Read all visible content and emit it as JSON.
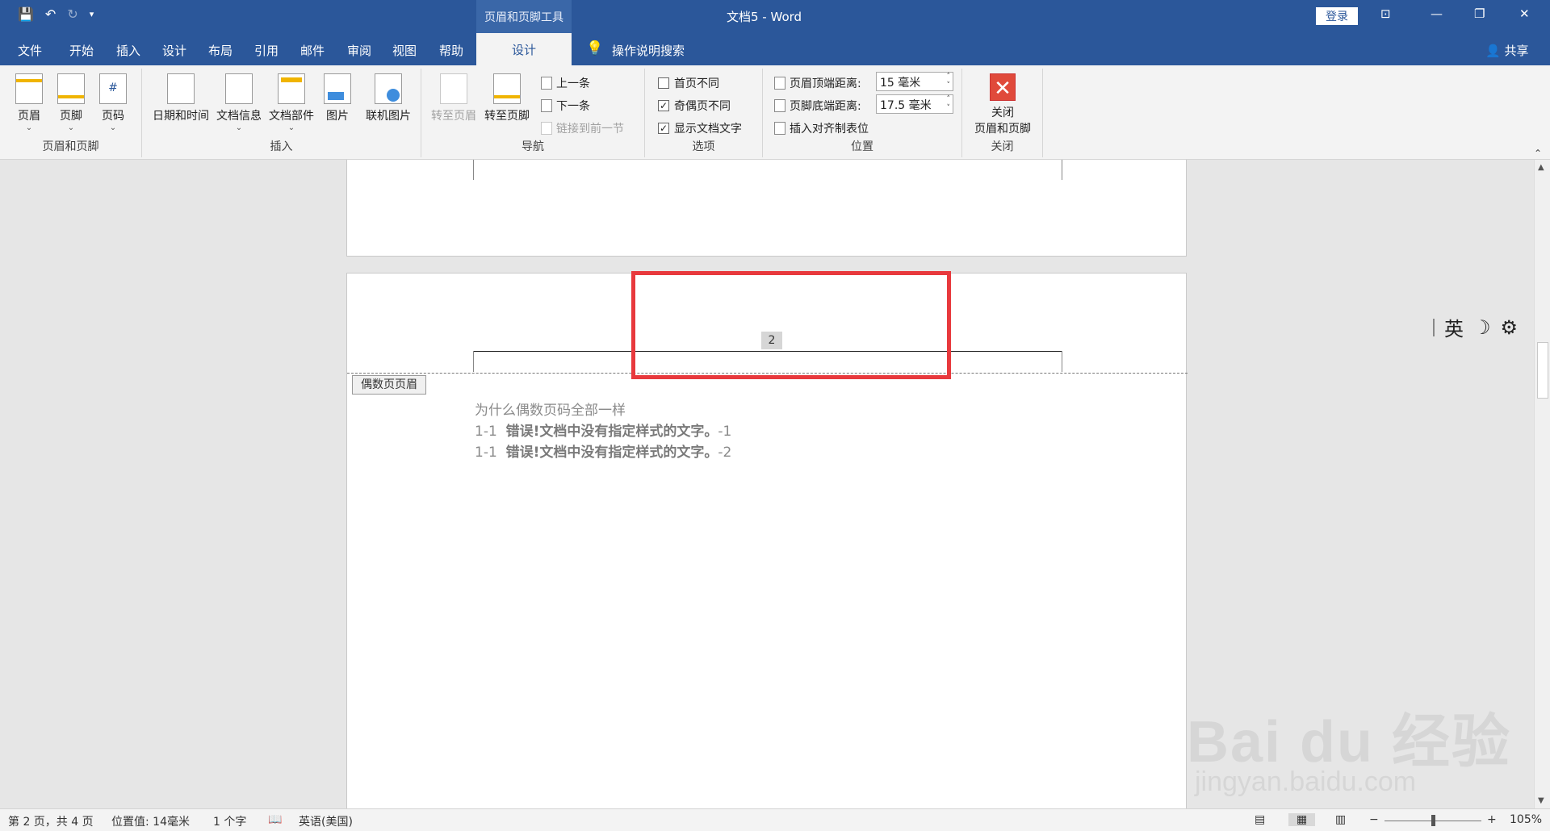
{
  "titlebar": {
    "context_tab": "页眉和页脚工具",
    "doc_title": "文档5 - Word",
    "login": "登录",
    "qat": {
      "save_icon": "save-icon",
      "undo_icon": "undo-icon",
      "redo_icon": "redo-icon",
      "customize": "▾"
    }
  },
  "tabs": {
    "items": [
      "文件",
      "开始",
      "插入",
      "设计",
      "布局",
      "引用",
      "邮件",
      "审阅",
      "视图",
      "帮助"
    ],
    "active": "设计",
    "search": "操作说明搜索",
    "share": "共享"
  },
  "ribbon": {
    "group_header_footer": {
      "label": "页眉和页脚",
      "header": "页眉",
      "footer": "页脚",
      "page_number": "页码"
    },
    "group_insert": {
      "label": "插入",
      "datetime": "日期和时间",
      "docinfo": "文档信息",
      "quickparts": "文档部件",
      "picture": "图片",
      "online_picture": "联机图片"
    },
    "group_nav": {
      "label": "导航",
      "goto_header": "转至页眉",
      "goto_footer": "转至页脚",
      "previous": "上一条",
      "next": "下一条",
      "link_previous": "链接到前一节"
    },
    "group_options": {
      "label": "选项",
      "different_first": "首页不同",
      "different_odd_even": "奇偶页不同",
      "show_doc_text": "显示文档文字"
    },
    "group_position": {
      "label": "位置",
      "header_from_top_label": "页眉顶端距离:",
      "header_from_top_value": "15 毫米",
      "footer_from_bottom_label": "页脚底端距离:",
      "footer_from_bottom_value": "17.5 毫米",
      "insert_align_tab": "插入对齐制表位"
    },
    "group_close": {
      "label": "关闭",
      "close_line1": "关闭",
      "close_line2": "页眉和页脚"
    }
  },
  "document": {
    "page_number_field": "2",
    "header_tag": "偶数页页眉",
    "lines": [
      {
        "text": "为什么偶数页码全部一样"
      },
      {
        "prefix": "1-1",
        "error": "错误!文档中没有指定样式的文字。",
        "suffix": "-1"
      },
      {
        "prefix": "1-1",
        "error": "错误!文档中没有指定样式的文字。",
        "suffix": "-2"
      }
    ],
    "highlight_color": "#e8393d"
  },
  "ime": {
    "lang": "英",
    "moon_icon": "moon-icon",
    "gear_icon": "gear-icon"
  },
  "statusbar": {
    "page": "第 2 页，共 4 页",
    "position": "位置值: 14毫米",
    "words": "1 个字",
    "language": "英语(美国)",
    "zoom": "105%"
  },
  "watermark": {
    "line1": "Bai du 经验",
    "line2": "jingyan.baidu.com"
  }
}
